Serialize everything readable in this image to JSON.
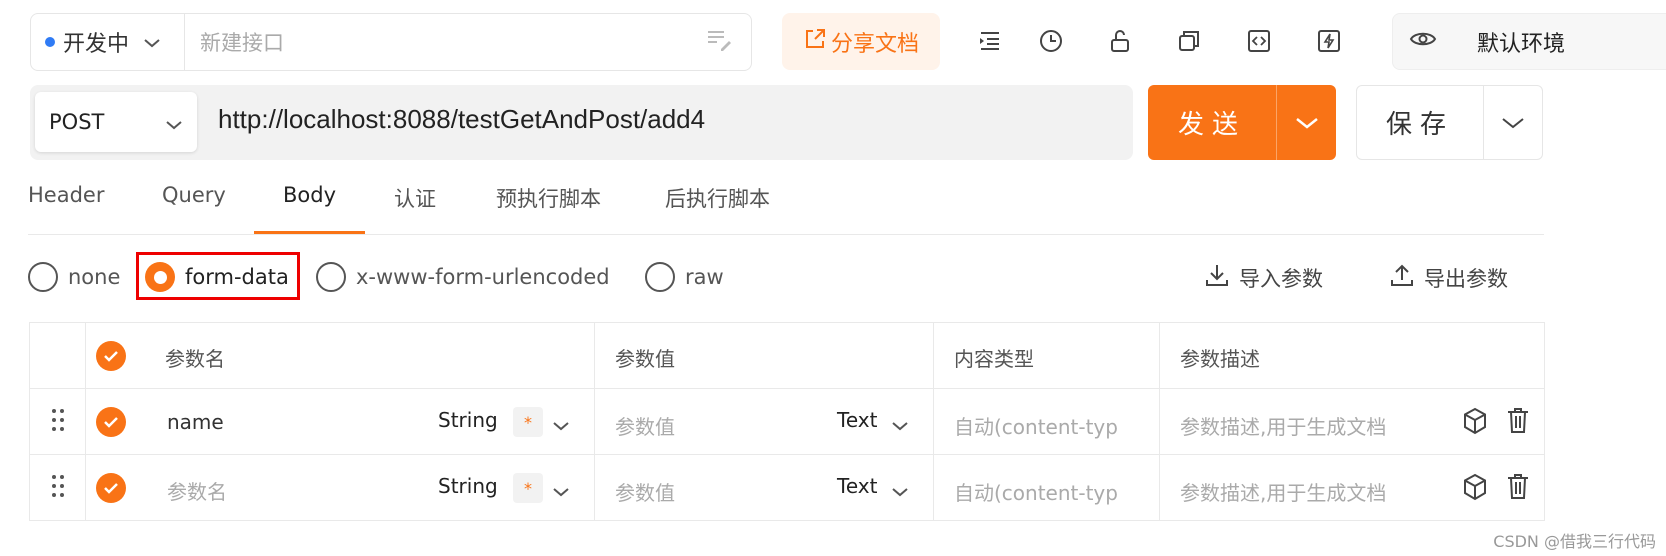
{
  "top": {
    "status_label": "开发中",
    "name_placeholder": "新建接口",
    "share_label": "分享文档",
    "env_label": "默认环境"
  },
  "request": {
    "method": "POST",
    "url": "http://localhost:8088/testGetAndPost/add4",
    "send_label": "发送",
    "save_label": "保存"
  },
  "tabs": [
    "Header",
    "Query",
    "Body",
    "认证",
    "预执行脚本",
    "后执行脚本"
  ],
  "active_tab": "Body",
  "body_types": [
    "none",
    "form-data",
    "x-www-form-urlencoded",
    "raw"
  ],
  "selected_body_type": "form-data",
  "actions": {
    "import": "导入参数",
    "export": "导出参数"
  },
  "table": {
    "headers": {
      "name": "参数名",
      "value": "参数值",
      "content_type": "内容类型",
      "desc": "参数描述"
    },
    "rows": [
      {
        "name": "name",
        "name_is_placeholder": false,
        "type": "String",
        "required_mark": "*",
        "value_placeholder": "参数值",
        "value_type": "Text",
        "content_type_placeholder": "自动(content-typ",
        "desc_placeholder": "参数描述,用于生成文档"
      },
      {
        "name": "参数名",
        "name_is_placeholder": true,
        "type": "String",
        "required_mark": "*",
        "value_placeholder": "参数值",
        "value_type": "Text",
        "content_type_placeholder": "自动(content-typ",
        "desc_placeholder": "参数描述,用于生成文档"
      }
    ]
  },
  "watermark": "CSDN @借我三行代码",
  "colors": {
    "accent": "#f97316",
    "highlight_box": "#e00000",
    "status_dot": "#2f7bf5"
  }
}
